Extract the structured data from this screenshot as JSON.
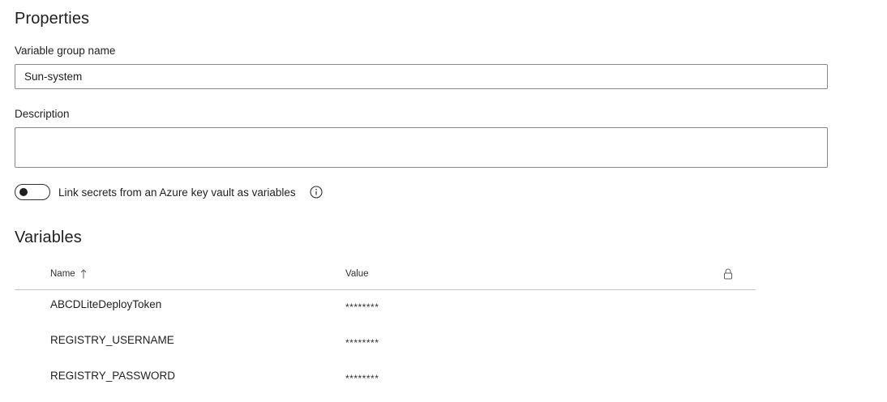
{
  "properties": {
    "title": "Properties",
    "group_name_label": "Variable group name",
    "group_name_value": "Sun-system",
    "description_label": "Description",
    "description_value": ""
  },
  "keyvault_toggle": {
    "label": "Link secrets from an Azure key vault as variables",
    "enabled": false,
    "info_icon": "info-icon"
  },
  "variables": {
    "title": "Variables",
    "columns": {
      "name": "Name",
      "value": "Value",
      "secret": "lock-icon"
    },
    "sort_icon": "arrow-up-icon",
    "rows": [
      {
        "name": "ABCDLiteDeployToken",
        "value": "********"
      },
      {
        "name": "REGISTRY_USERNAME",
        "value": "********"
      },
      {
        "name": "REGISTRY_PASSWORD",
        "value": "********"
      }
    ]
  }
}
